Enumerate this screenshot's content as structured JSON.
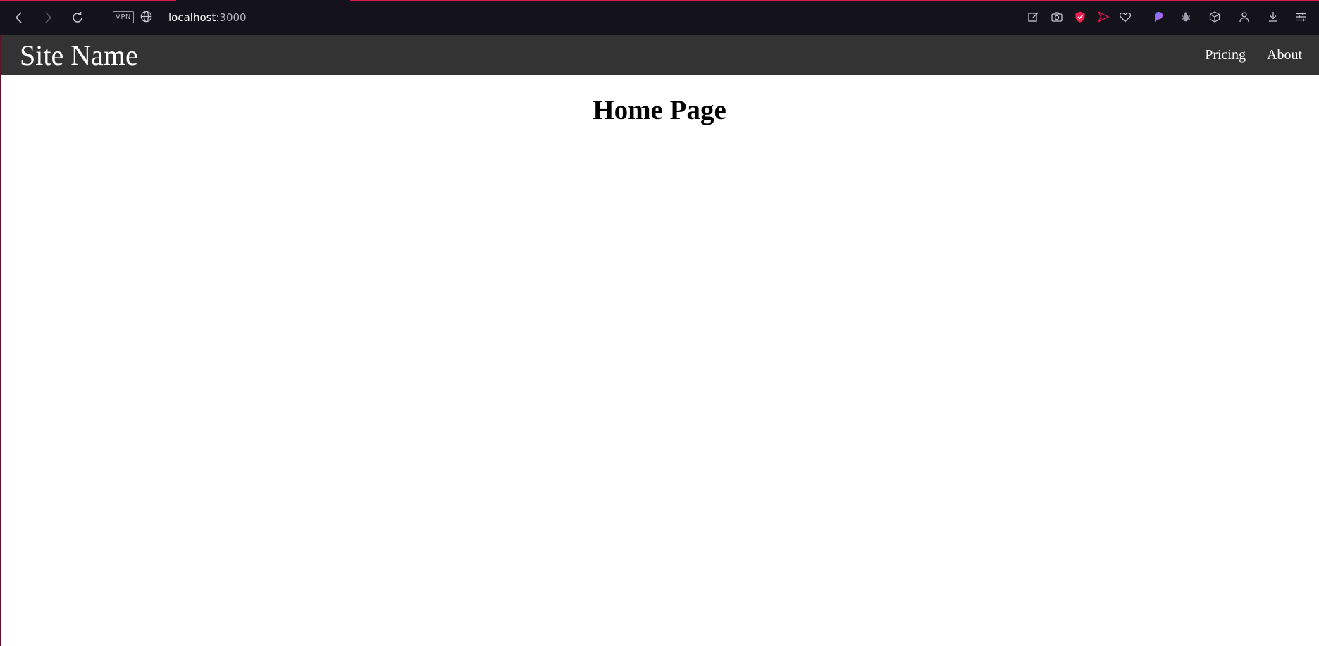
{
  "browser": {
    "vpn_label": "VPN",
    "url_host": "localhost",
    "url_port": ":3000",
    "accent_color": "#e0194a",
    "toolbar_color": "#14121b",
    "icons": [
      "back-icon",
      "forward-icon",
      "reload-icon",
      "globe-icon",
      "snapshot-edit-icon",
      "camera-icon",
      "shield-icon",
      "send-icon",
      "heart-icon",
      "aria-icon",
      "bug-icon",
      "cube-icon",
      "profile-icon",
      "download-icon",
      "easy-setup-icon"
    ]
  },
  "site": {
    "name": "Site Name",
    "nav": {
      "pricing": "Pricing",
      "about": "About"
    },
    "navbar_color": "#333333"
  },
  "main": {
    "title": "Home Page"
  }
}
